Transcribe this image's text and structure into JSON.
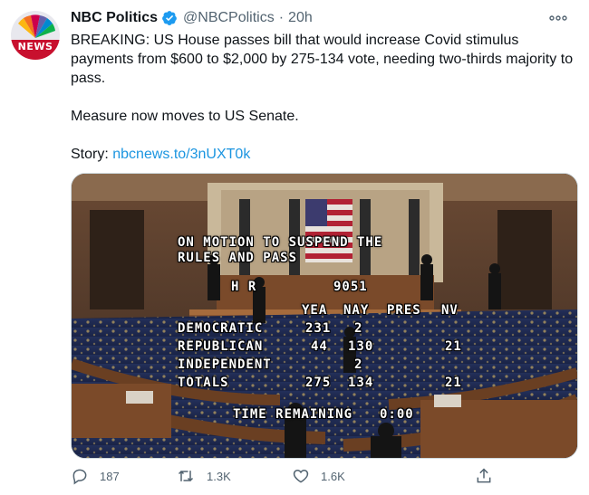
{
  "author": {
    "name": "NBC Politics",
    "handle": "@NBCPolitics",
    "separator": "·",
    "time": "20h",
    "avatar_label": "NEWS"
  },
  "icons": {
    "verified": "verified-badge-icon",
    "more": "more-options-icon",
    "reply": "reply-icon",
    "retweet": "retweet-icon",
    "like": "like-icon",
    "share": "share-icon"
  },
  "colors": {
    "accent": "#1b95e0",
    "muted": "#536471",
    "text": "#0f1419"
  },
  "tweet": {
    "line1": "BREAKING: US House passes bill that would increase Covid stimulus payments from $600 to $2,000 by 275-134 vote, needing two-thirds majority to pass.",
    "line2": "Measure now moves to US Senate.",
    "story_label": "Story:",
    "story_link": "nbcnews.to/3nUXT0k"
  },
  "vote_board": {
    "motion_line1": "ON MOTION TO SUSPEND THE",
    "motion_line2": "RULES AND PASS",
    "bill_type": "H  R",
    "bill_number": "9051",
    "headers": {
      "yea": "YEA",
      "nay": "NAY",
      "pres": "PRES",
      "nv": "NV"
    },
    "rows": [
      {
        "party": "DEMOCRATIC",
        "yea": "231",
        "nay": "2",
        "pres": "",
        "nv": ""
      },
      {
        "party": "REPUBLICAN",
        "yea": "44",
        "nay": "130",
        "pres": "",
        "nv": "21"
      },
      {
        "party": "INDEPENDENT",
        "yea": "",
        "nay": "2",
        "pres": "",
        "nv": ""
      },
      {
        "party": "TOTALS",
        "yea": "275",
        "nay": "134",
        "pres": "",
        "nv": "21"
      }
    ],
    "time_remaining_label": "TIME REMAINING",
    "time_remaining_value": "0:00"
  },
  "actions": {
    "replies": "187",
    "retweets": "1.3K",
    "likes": "1.6K"
  }
}
